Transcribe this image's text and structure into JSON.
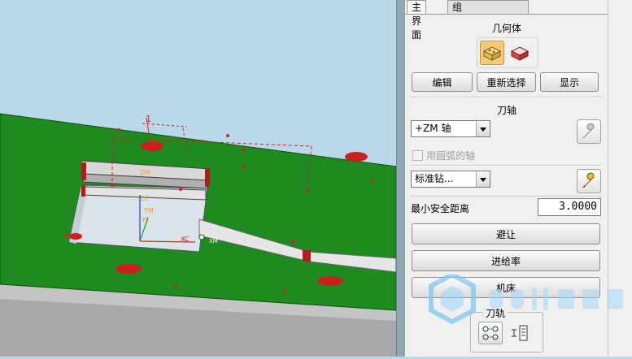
{
  "tabs": [
    {
      "label": "主界面"
    },
    {
      "label": "组"
    }
  ],
  "geometry": {
    "title": "几何体",
    "icons": [
      "part-geometry-icon",
      "blank-geometry-icon"
    ],
    "edit_label": "编辑",
    "reselect_label": "重新选择",
    "display_label": "显示"
  },
  "tool_axis": {
    "title": "刀轴",
    "axis_value": "+ZM 轴",
    "use_arc_axis_label": "用圆弧的轴",
    "use_arc_axis_checked": false,
    "wrench_icon": "wrench-icon"
  },
  "cycle": {
    "type_value": "标准钻...",
    "wrench_icon": "wrench-icon"
  },
  "min_clearance": {
    "label": "最小安全距离",
    "value": "3.0000"
  },
  "buttons": {
    "avoid": "避让",
    "feeds": "进给率",
    "machine": "机床"
  },
  "toolpath": {
    "title": "刀轨",
    "icons": [
      "generate-toolpath-icon",
      "list-toolpath-icon"
    ]
  },
  "viewport": {
    "axis_labels": {
      "zm": "ZM",
      "zc": "ZC",
      "ym": "YM",
      "yc": "YC",
      "xc": "XC",
      "xm": "XM"
    },
    "marker_label": "1"
  },
  "colors": {
    "plate_green": "#1f8a1f",
    "hole_red": "#cc1f1f",
    "background": "#b9d8ea",
    "panel": "#f0f0f0"
  }
}
